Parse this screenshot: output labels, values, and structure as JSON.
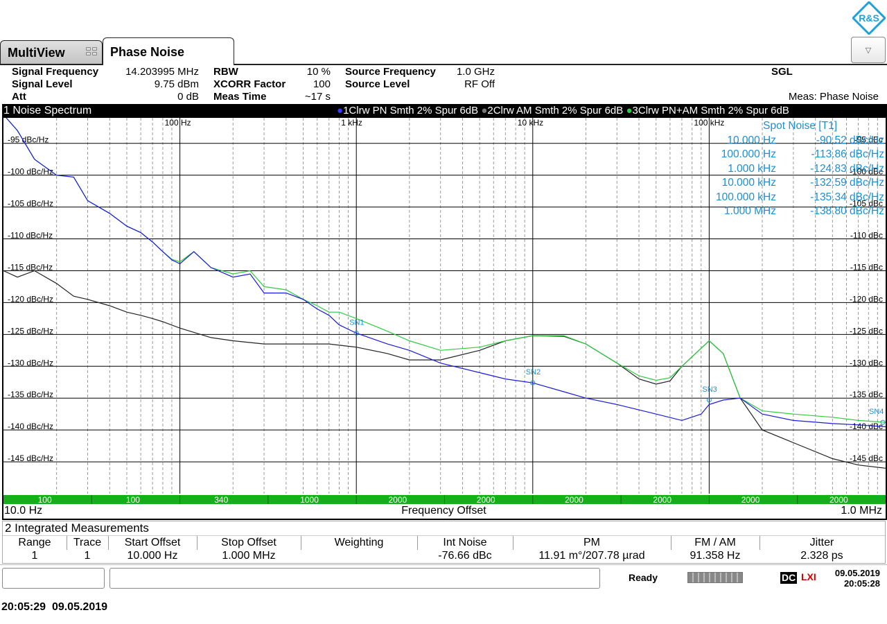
{
  "tabs": [
    {
      "label": "MultiView"
    },
    {
      "label": "Phase Noise"
    }
  ],
  "logo_text": "R&S",
  "params": {
    "signal_frequency": {
      "label": "Signal Frequency",
      "value": "14.203995 MHz"
    },
    "signal_level": {
      "label": "Signal Level",
      "value": "9.75 dBm"
    },
    "att": {
      "label": "Att",
      "value": "0 dB"
    },
    "rbw": {
      "label": "RBW",
      "value": "10 %"
    },
    "xcorr": {
      "label": "XCORR Factor",
      "value": "100"
    },
    "meas_time": {
      "label": "Meas Time",
      "value": "~17 s"
    },
    "source_frequency": {
      "label": "Source Frequency",
      "value": "1.0 GHz"
    },
    "source_level": {
      "label": "Source Level",
      "value": "RF Off"
    },
    "sgl": "SGL",
    "meas": "Meas: Phase Noise"
  },
  "diagram": {
    "title": "1 Noise Spectrum",
    "traces_legend": [
      {
        "text": "1Clrw PN Smth 2% Spur 6dB",
        "color": "#1a1adc"
      },
      {
        "text": "2Clrw AM Smth 2% Spur 6dB",
        "color": "#222222"
      },
      {
        "text": "3Clrw PN+AM Smth 2% Spur 6dB",
        "color": "#2ecc40"
      }
    ],
    "freq_start": "10.0 Hz",
    "freq_label": "Frequency Offset",
    "freq_stop": "1.0 MHz"
  },
  "spot_noise": {
    "title": "Spot Noise [T1]",
    "rows": [
      {
        "offset": "10.000 Hz",
        "value": "-90.52 dBc/Hz"
      },
      {
        "offset": "100.000 Hz",
        "value": "-113.86 dBc/Hz"
      },
      {
        "offset": "1.000 kHz",
        "value": "-124.83 dBc/Hz"
      },
      {
        "offset": "10.000 kHz",
        "value": "-132.59 dBc/Hz"
      },
      {
        "offset": "100.000 kHz",
        "value": "-135.34 dBc/Hz"
      },
      {
        "offset": "1.000 MHz",
        "value": "-138.80 dBc/Hz"
      }
    ]
  },
  "chart_data": {
    "type": "line",
    "x_scale": "log",
    "xlim": [
      10,
      1000000
    ],
    "ylim": [
      -150,
      -91
    ],
    "x_ticks": [
      {
        "value": 100,
        "label": "100 Hz"
      },
      {
        "value": 1000,
        "label": "1 kHz"
      },
      {
        "value": 10000,
        "label": "10 kHz"
      },
      {
        "value": 100000,
        "label": "100 kHz"
      }
    ],
    "y_ticks_left": [
      "-95 dBc/Hz",
      "-100 dBc/Hz",
      "-105 dBc/Hz",
      "-110 dBc/Hz",
      "-115 dBc/Hz",
      "-120 dBc/Hz",
      "-125 dBc/Hz",
      "-130 dBc/Hz",
      "-135 dBc/Hz",
      "-140 dBc/Hz",
      "-145 dBc/Hz"
    ],
    "y_ticks_right": [
      "-95 dBc",
      "-100 dBc",
      "-105 dBc",
      "-110 dBc",
      "-115 dBc",
      "-120 dBc",
      "-125 dBc",
      "-130 dBc",
      "-135 dBc",
      "-140 dBc",
      "-145 dBc"
    ],
    "y_tick_values": [
      -95,
      -100,
      -105,
      -110,
      -115,
      -120,
      -125,
      -130,
      -135,
      -140,
      -145
    ],
    "grid": true,
    "series": [
      {
        "name": "1Clrw PN Smth 2% Spur 6dB",
        "color": "#1a1adc",
        "x": [
          10,
          12,
          15,
          20,
          25,
          30,
          40,
          50,
          60,
          70,
          80,
          90,
          100,
          120,
          150,
          200,
          250,
          300,
          400,
          500,
          600,
          700,
          800,
          1000,
          1500,
          2000,
          3000,
          5000,
          7000,
          10000,
          15000,
          20000,
          30000,
          50000,
          70000,
          90000,
          100000,
          120000,
          150000,
          200000,
          300000,
          500000,
          700000,
          1000000
        ],
        "y": [
          -90.5,
          -93,
          -97.5,
          -100,
          -100.3,
          -104,
          -106,
          -108,
          -109,
          -110.5,
          -112,
          -113.3,
          -113.9,
          -112,
          -114.5,
          -116,
          -115.5,
          -118.5,
          -118.5,
          -119.5,
          -121,
          -122,
          -123.5,
          -124.8,
          -126.5,
          -127.5,
          -129.5,
          -131,
          -132,
          -132.6,
          -134,
          -135,
          -136,
          -137.5,
          -138.5,
          -137.5,
          -136,
          -135.3,
          -135,
          -137.5,
          -138.5,
          -139,
          -139.2,
          -139.5
        ]
      },
      {
        "name": "2Clrw AM Smth 2% Spur 6dB",
        "color": "#222222",
        "x": [
          10,
          12,
          15,
          20,
          25,
          30,
          40,
          50,
          60,
          70,
          80,
          100,
          150,
          200,
          300,
          500,
          700,
          1000,
          1500,
          2000,
          3000,
          5000,
          7000,
          10000,
          15000,
          20000,
          30000,
          40000,
          50000,
          60000,
          70000,
          100000,
          120000,
          150000,
          200000,
          300000,
          500000,
          700000,
          1000000
        ],
        "y": [
          -115,
          -116,
          -115,
          -117,
          -119,
          -119.5,
          -120.5,
          -121.5,
          -122,
          -122.5,
          -123,
          -124,
          -125.5,
          -126,
          -126.5,
          -126.5,
          -126.5,
          -127,
          -128,
          -129,
          -129,
          -127.5,
          -126,
          -125.2,
          -125.3,
          -126.5,
          -129.5,
          -132,
          -132.8,
          -132.3,
          -130,
          -126,
          -128,
          -135,
          -140,
          -142,
          -144.5,
          -145.5,
          -146
        ]
      },
      {
        "name": "3Clrw PN+AM Smth 2% Spur 6dB",
        "color": "#2ecc40",
        "x": [
          10,
          12,
          15,
          20,
          25,
          30,
          40,
          50,
          60,
          70,
          80,
          90,
          100,
          120,
          150,
          200,
          250,
          300,
          400,
          500,
          600,
          700,
          800,
          1000,
          1500,
          2000,
          3000,
          5000,
          7000,
          10000,
          15000,
          20000,
          30000,
          40000,
          50000,
          60000,
          70000,
          100000,
          120000,
          150000,
          200000,
          300000,
          500000,
          700000,
          1000000
        ],
        "y": [
          -90.5,
          -93,
          -97.5,
          -100,
          -100.3,
          -104,
          -106,
          -108,
          -109,
          -110.5,
          -112,
          -113.2,
          -113.6,
          -112,
          -114.5,
          -115.5,
          -115,
          -117.5,
          -118,
          -119.5,
          -120.5,
          -121.5,
          -121.5,
          -122.5,
          -124.5,
          -126,
          -127.5,
          -127,
          -126,
          -125.2,
          -125.2,
          -126.5,
          -129.5,
          -131.5,
          -132.2,
          -131.8,
          -130,
          -126,
          -128,
          -135,
          -137,
          -137.5,
          -138,
          -138.5,
          -138.8
        ]
      }
    ],
    "bottom_band": [
      "100",
      "100",
      "340",
      "1000",
      "2000",
      "2000",
      "2000",
      "2000",
      "2000",
      "2000"
    ],
    "markers": [
      {
        "label": "SN1",
        "x": 1000,
        "y": -124.8
      },
      {
        "label": "SN2",
        "x": 10000,
        "y": -132.6
      },
      {
        "label": "SN3",
        "x": 100000,
        "y": -135.3
      },
      {
        "label": "SN4",
        "x": 1000000,
        "y": -138.8
      }
    ]
  },
  "integrated": {
    "title": "2 Integrated Measurements",
    "headers": [
      "Range",
      "Trace",
      "Start Offset",
      "Stop Offset",
      "Weighting",
      "Int Noise",
      "PM",
      "FM / AM",
      "Jitter"
    ],
    "row": [
      "1",
      "1",
      "10.000 Hz",
      "1.000 MHz",
      "",
      "-76.66 dBc",
      "11.91 m°/207.78 µrad",
      "91.358 Hz",
      "2.328 ps"
    ]
  },
  "status": {
    "ready": "Ready",
    "dc_label": "DC",
    "date": "09.05.2019",
    "time": "20:05:28"
  },
  "footer_timestamp": "20:05:29  09.05.2019"
}
